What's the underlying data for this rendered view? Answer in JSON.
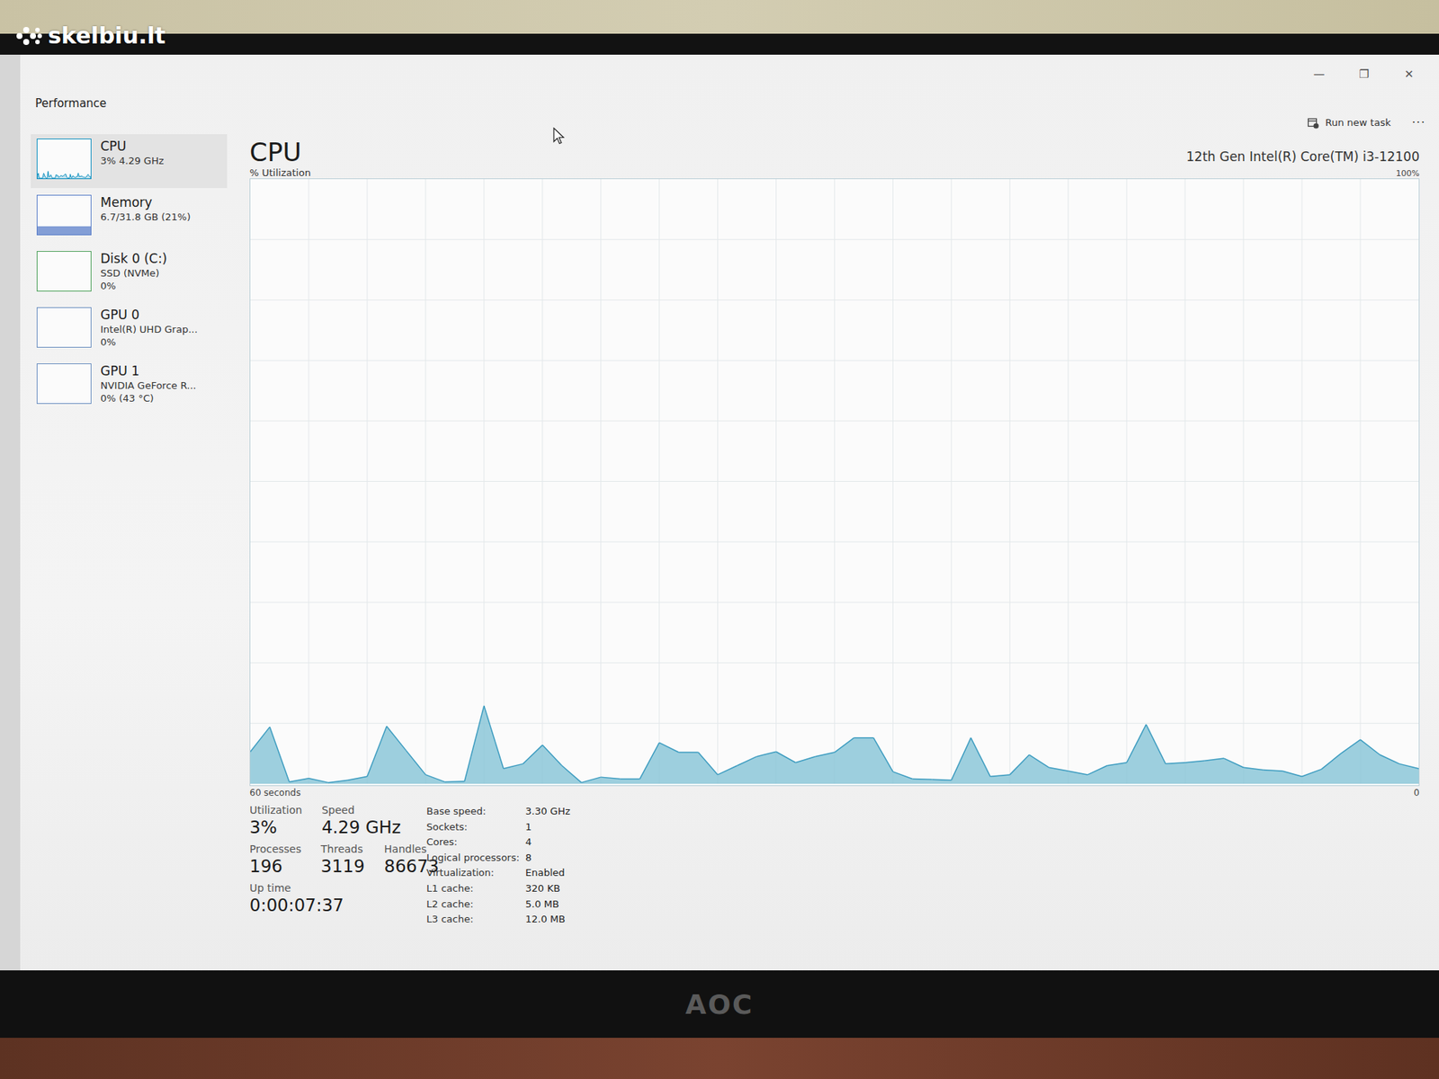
{
  "watermark": {
    "text": "skelbiu.lt"
  },
  "window": {
    "title": "Performance",
    "controls": [
      "—",
      "❐",
      "✕"
    ]
  },
  "toolbar": {
    "run_new_task": "Run new task",
    "more": "···"
  },
  "sidebar": {
    "items": [
      {
        "name": "CPU",
        "lines": [
          "3% 4.29 GHz"
        ],
        "selected": true,
        "kind": "graph",
        "color": "#1191c1"
      },
      {
        "name": "Memory",
        "lines": [
          "6.7/31.8 GB (21%)"
        ],
        "selected": false,
        "kind": "bar",
        "level": 0.21,
        "color": "#5b7fc9"
      },
      {
        "name": "Disk 0 (C:)",
        "lines": [
          "SSD (NVMe)",
          "0%"
        ],
        "selected": false,
        "kind": "bar",
        "level": 0,
        "color": "#4da05a"
      },
      {
        "name": "GPU 0",
        "lines": [
          "Intel(R) UHD Grap...",
          "0%"
        ],
        "selected": false,
        "kind": "bar",
        "level": 0,
        "color": "#6b8fc0"
      },
      {
        "name": "GPU 1",
        "lines": [
          "NVIDIA GeForce R...",
          "0% (43 °C)"
        ],
        "selected": false,
        "kind": "bar",
        "level": 0,
        "color": "#6b8fc0"
      }
    ]
  },
  "main": {
    "title": "CPU",
    "subtitle": "% Utilization",
    "processor": "12th Gen Intel(R) Core(TM) i3-12100"
  },
  "chart": {
    "y_max_label": "100%",
    "x_left_label": "60 seconds",
    "x_right_label": "0",
    "max": 100,
    "values": [
      5.3,
      9.4,
      0.3,
      0.9,
      0.2,
      0.6,
      1.2,
      9.5,
      5.5,
      1.5,
      0.3,
      0.4,
      12.9,
      2.5,
      3.3,
      6.4,
      3,
      0.2,
      1.1,
      0.8,
      0.8,
      6.8,
      5.2,
      5.2,
      1.5,
      3,
      4.5,
      5.3,
      3.5,
      4.5,
      5.2,
      7.6,
      7.6,
      2,
      0.8,
      0.7,
      0.6,
      7.6,
      1.2,
      1.5,
      4.8,
      2.7,
      2.1,
      1.5,
      3,
      3.5,
      9.8,
      3.3,
      3.5,
      3.8,
      4.2,
      2.7,
      2.3,
      2.1,
      1.2,
      2.4,
      5,
      7.3,
      4.8,
      3.3,
      2.5
    ]
  },
  "stats": [
    [
      {
        "label": "Utilization",
        "value": "3%"
      },
      {
        "label": "Speed",
        "value": "4.29 GHz"
      }
    ],
    [
      {
        "label": "Processes",
        "value": "196"
      },
      {
        "label": "Threads",
        "value": "3119"
      },
      {
        "label": "Handles",
        "value": "86673"
      }
    ],
    [
      {
        "label": "Up time",
        "value": "0:00:07:37"
      }
    ]
  ],
  "details": [
    {
      "key": "Base speed:",
      "value": "3.30 GHz"
    },
    {
      "key": "Sockets:",
      "value": "1"
    },
    {
      "key": "Cores:",
      "value": "4"
    },
    {
      "key": "Logical processors:",
      "value": "8"
    },
    {
      "key": "Virtualization:",
      "value": "Enabled"
    },
    {
      "key": "L1 cache:",
      "value": "320 KB"
    },
    {
      "key": "L2 cache:",
      "value": "5.0 MB"
    },
    {
      "key": "L3 cache:",
      "value": "12.0 MB"
    }
  ],
  "monitor": {
    "brand": "AOC"
  }
}
